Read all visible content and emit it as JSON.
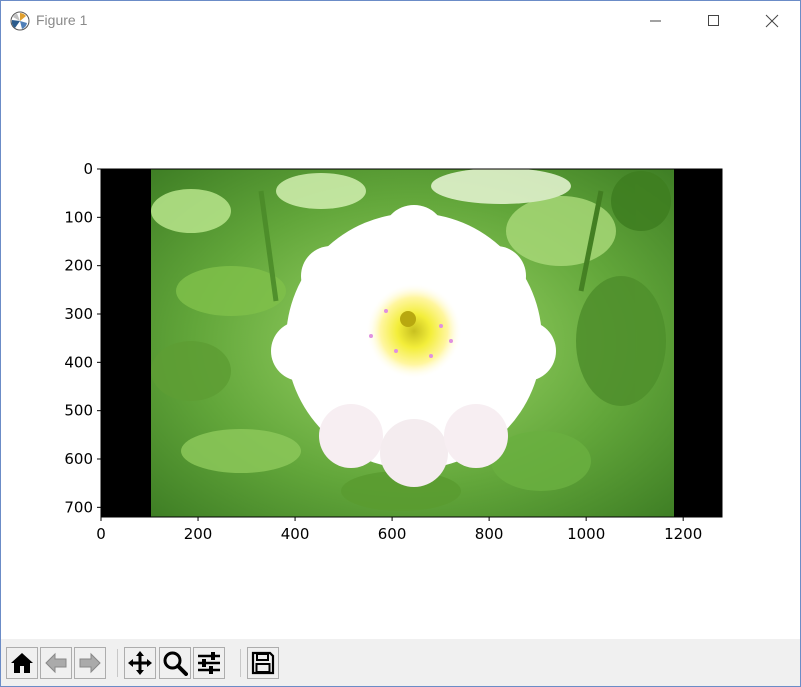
{
  "window": {
    "title": "Figure 1",
    "icon": "matplotlib-icon",
    "controls": [
      "minimize-icon",
      "maximize-icon",
      "close-icon"
    ]
  },
  "chart_data": {
    "type": "image",
    "title": "",
    "xlabel": "",
    "ylabel": "",
    "xlim": [
      0,
      1280
    ],
    "ylim": [
      720,
      0
    ],
    "xticks": [
      0,
      200,
      400,
      600,
      800,
      1000,
      1200
    ],
    "yticks": [
      0,
      100,
      200,
      300,
      400,
      500,
      600,
      700
    ],
    "xtick_labels": [
      "0",
      "200",
      "400",
      "600",
      "800",
      "1000",
      "1200"
    ],
    "ytick_labels": [
      "0",
      "100",
      "200",
      "300",
      "400",
      "500",
      "600",
      "700"
    ],
    "content": {
      "black_bar_left": [
        0,
        100
      ],
      "photo_x": [
        100,
        1180
      ],
      "black_bar_right": [
        1180,
        1280
      ],
      "subject": "white dahlia flower with green leaves background",
      "colors": {
        "border": "#000000",
        "leaf": "#6fae3a",
        "petal": "#ffffff",
        "center": "#f0e040"
      }
    }
  },
  "toolbar": {
    "buttons": [
      {
        "name": "home-icon",
        "enabled": true
      },
      {
        "name": "back-arrow-icon",
        "enabled": false
      },
      {
        "name": "forward-arrow-icon",
        "enabled": false
      },
      {
        "name": "pan-icon",
        "enabled": true
      },
      {
        "name": "zoom-icon",
        "enabled": true
      },
      {
        "name": "subplots-config-icon",
        "enabled": true
      },
      {
        "name": "save-icon",
        "enabled": true
      }
    ]
  }
}
